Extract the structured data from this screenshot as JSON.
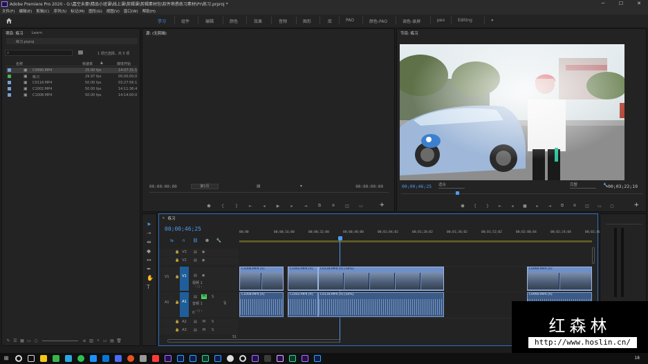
{
  "titlebar": {
    "title": "Adobe Premiere Pro 2020 - G:\\嘉空未豪\\精品小班课\\线上课\\剪辑课\\剪辑素材包\\软件熟悉练习素材\\Pr\\练习.prproj *",
    "minimize": "─",
    "maximize": "☐",
    "close": "✕"
  },
  "menubar": [
    "文件(F)",
    "编辑(E)",
    "剪辑(C)",
    "序列(S)",
    "标记(M)",
    "图形(G)",
    "视图(V)",
    "窗口(W)",
    "帮助(H)"
  ],
  "workspaces": {
    "tabs": [
      "学习",
      "组件",
      "编辑",
      "颜色",
      "效果",
      "音频",
      "图形",
      "库",
      "PAO",
      "颜色-PAO",
      "调色-录屏",
      "peo",
      "Editing"
    ],
    "active": "学习",
    "overflow": "»"
  },
  "project": {
    "tabs": [
      "项目: 练习",
      "Learn"
    ],
    "file": "练习.prproj",
    "selection_status": "1 项已选择，共 5 项",
    "columns": [
      "名称",
      "帧速率",
      "媒体开始"
    ],
    "items": [
      {
        "name": "C0990.MP4",
        "fps": "25.00 fps",
        "start": "14:07:31:1",
        "color": "#7a9fd6",
        "selected": true
      },
      {
        "name": "练习",
        "fps": "29.97 fps",
        "start": "00;00;00;0",
        "color": "#4caf50",
        "selected": false
      },
      {
        "name": "C0118.MP4",
        "fps": "50.00 fps",
        "start": "03:27:56:1",
        "color": "#7a9fd6",
        "selected": false
      },
      {
        "name": "C1002.MP4",
        "fps": "50.00 fps",
        "start": "14:11:36:4",
        "color": "#7a9fd6",
        "selected": false
      },
      {
        "name": "C1008.MP4",
        "fps": "50.00 fps",
        "start": "14:14:00:0",
        "color": "#7a9fd6",
        "selected": false
      }
    ]
  },
  "source_monitor": {
    "tab": "源: (无剪辑)",
    "timecode_left": "00:00:00:00",
    "fit": "第1页",
    "timecode_right": "00:00:00:00"
  },
  "program_monitor": {
    "tab": "节目: 练习",
    "timecode": "00;00;46;25",
    "fit": "适合",
    "quality": "完整",
    "duration": "00;03;22;19",
    "playhead_fraction": 0.23
  },
  "timeline": {
    "tab": "练习",
    "timecode": "00;00;46;25",
    "ruler": [
      "00;00",
      "00;00;16;00",
      "00;00;32;00",
      "00;00;48;00",
      "00;01;04;02",
      "00;01;20;02",
      "00;01;36;02",
      "00;01;52;02",
      "00;02;08;04",
      "00;02;24;04",
      "00;02;40;04"
    ],
    "video_tracks": [
      {
        "id": "V3",
        "name": ""
      },
      {
        "id": "V2",
        "name": ""
      },
      {
        "id": "V1",
        "name": "视频 1"
      }
    ],
    "audio_tracks": [
      {
        "id": "A1",
        "name": "音频 1"
      },
      {
        "id": "A2",
        "name": ""
      },
      {
        "id": "A3",
        "name": ""
      }
    ],
    "master_value": "0.",
    "mix_label": "S1",
    "track_buttons": {
      "mute": "M",
      "solo": "S"
    },
    "video_clips": [
      "C1008.MP4 [V]",
      "C1002.MP4 [V]",
      "C0118.MP4 [V] [50%]",
      "C0990.MP4 [V]"
    ],
    "audio_clips": [
      "C1008.MP4 [A]",
      "C1002.MP4 [A]",
      "C0118.MP4 [A] [50%]",
      "C0990.MP4 [A]"
    ]
  },
  "watermark": {
    "title": "红森林",
    "url": "http://www.hoslin.cn/"
  },
  "taskbar": {
    "clock": "18"
  }
}
